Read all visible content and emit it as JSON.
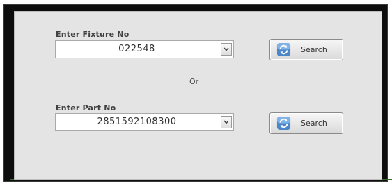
{
  "fixture": {
    "label": "Enter Fixture No",
    "value": "022548",
    "search_label": "Search"
  },
  "separator": "Or",
  "part": {
    "label": "Enter Part No",
    "value": "2851592108300",
    "search_label": "Search"
  },
  "icons": {
    "dropdown": "chevron-down-icon",
    "search": "refresh-search-icon"
  }
}
